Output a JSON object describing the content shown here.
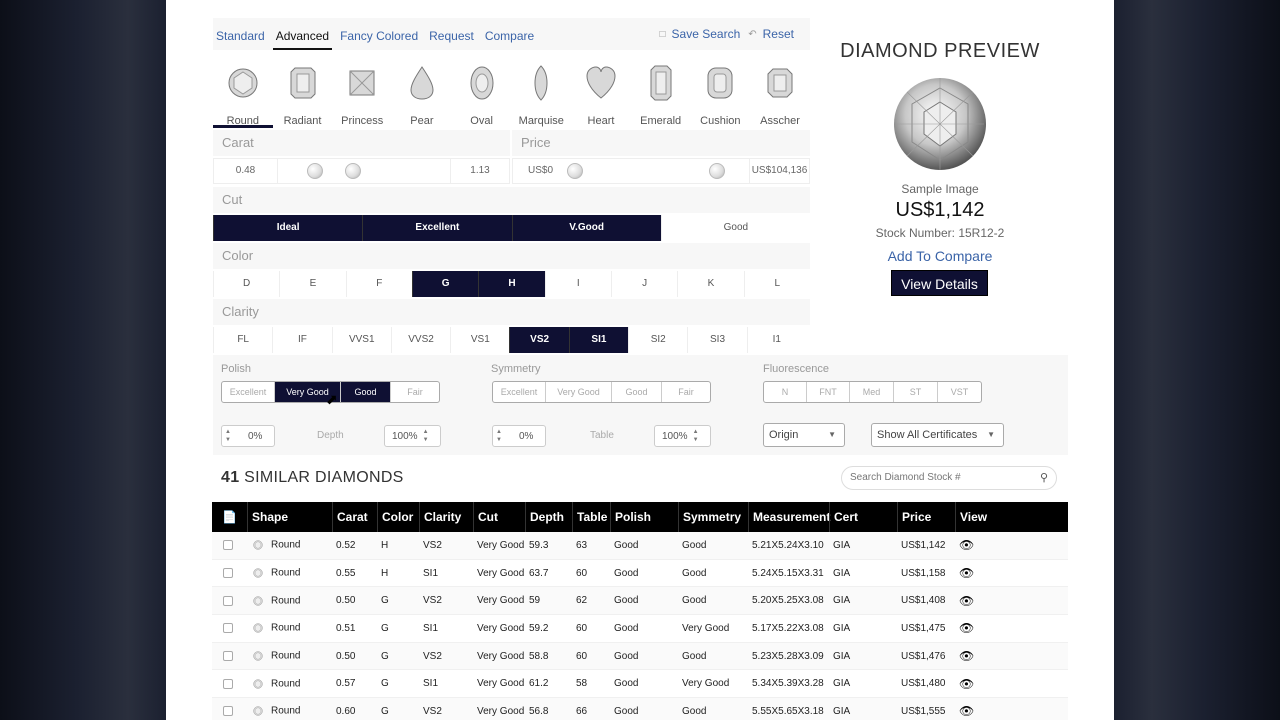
{
  "tabs": [
    "Standard",
    "Advanced",
    "Fancy Colored",
    "Request",
    "Compare"
  ],
  "actions": {
    "save": "Save Search",
    "reset": "Reset"
  },
  "shapes": [
    "Round",
    "Radiant",
    "Princess",
    "Pear",
    "Oval",
    "Marquise",
    "Heart",
    "Emerald",
    "Cushion",
    "Asscher"
  ],
  "shape_selected": "Round",
  "carat": {
    "label": "Carat",
    "min": "0.48",
    "max": "1.13"
  },
  "price": {
    "label": "Price",
    "min": "US$0",
    "max": "US$104,136"
  },
  "cut": {
    "label": "Cut",
    "options": [
      "Ideal",
      "Excellent",
      "V.Good",
      "Good"
    ],
    "selected": [
      "Ideal",
      "Excellent",
      "V.Good"
    ]
  },
  "color": {
    "label": "Color",
    "options": [
      "D",
      "E",
      "F",
      "G",
      "H",
      "I",
      "J",
      "K",
      "L"
    ],
    "selected": [
      "G",
      "H"
    ]
  },
  "clarity": {
    "label": "Clarity",
    "options": [
      "FL",
      "IF",
      "VVS1",
      "VVS2",
      "VS1",
      "VS2",
      "SI1",
      "SI2",
      "SI3",
      "I1"
    ],
    "selected": [
      "VS2",
      "SI1"
    ]
  },
  "polish": {
    "label": "Polish",
    "options": [
      "Excellent",
      "Very Good",
      "Good",
      "Fair"
    ],
    "selected": [
      "Very Good",
      "Good"
    ]
  },
  "symmetry": {
    "label": "Symmetry",
    "options": [
      "Excellent",
      "Very Good",
      "Good",
      "Fair"
    ]
  },
  "fluorescence": {
    "label": "Fluorescence",
    "options": [
      "N",
      "FNT",
      "Med",
      "ST",
      "VST"
    ]
  },
  "depth": {
    "label": "Depth",
    "min": "0%",
    "max": "100%"
  },
  "table_range": {
    "label": "Table",
    "min": "0%",
    "max": "100%"
  },
  "origin": "Origin",
  "certificates": "Show All Certificates",
  "results": {
    "count": "41",
    "label": "SIMILAR DIAMONDS",
    "search_placeholder": "Search Diamond Stock #"
  },
  "columns": [
    "Shape",
    "Carat",
    "Color",
    "Clarity",
    "Cut",
    "Depth",
    "Table",
    "Polish",
    "Symmetry",
    "Measurement",
    "Cert",
    "Price",
    "View"
  ],
  "rows": [
    [
      "Round",
      "0.52",
      "H",
      "VS2",
      "Very Good",
      "59.3",
      "63",
      "Good",
      "Good",
      "5.21X5.24X3.10",
      "GIA",
      "US$1,142"
    ],
    [
      "Round",
      "0.55",
      "H",
      "SI1",
      "Very Good",
      "63.7",
      "60",
      "Good",
      "Good",
      "5.24X5.15X3.31",
      "GIA",
      "US$1,158"
    ],
    [
      "Round",
      "0.50",
      "G",
      "VS2",
      "Very Good",
      "59",
      "62",
      "Good",
      "Good",
      "5.20X5.25X3.08",
      "GIA",
      "US$1,408"
    ],
    [
      "Round",
      "0.51",
      "G",
      "SI1",
      "Very Good",
      "59.2",
      "60",
      "Good",
      "Very Good",
      "5.17X5.22X3.08",
      "GIA",
      "US$1,475"
    ],
    [
      "Round",
      "0.50",
      "G",
      "VS2",
      "Very Good",
      "58.8",
      "60",
      "Good",
      "Good",
      "5.23X5.28X3.09",
      "GIA",
      "US$1,476"
    ],
    [
      "Round",
      "0.57",
      "G",
      "SI1",
      "Very Good",
      "61.2",
      "58",
      "Good",
      "Very Good",
      "5.34X5.39X3.28",
      "GIA",
      "US$1,480"
    ],
    [
      "Round",
      "0.60",
      "G",
      "VS2",
      "Very Good",
      "56.8",
      "66",
      "Good",
      "Good",
      "5.55X5.65X3.18",
      "GIA",
      "US$1,555"
    ]
  ],
  "preview": {
    "title": "DIAMOND PREVIEW",
    "caption": "Sample Image",
    "price": "US$1,142",
    "stock": "Stock Number: 15R12-2",
    "compare": "Add To Compare",
    "details": "View Details"
  },
  "colors": {
    "accent": "#0f1033",
    "link": "#3b64a8"
  }
}
